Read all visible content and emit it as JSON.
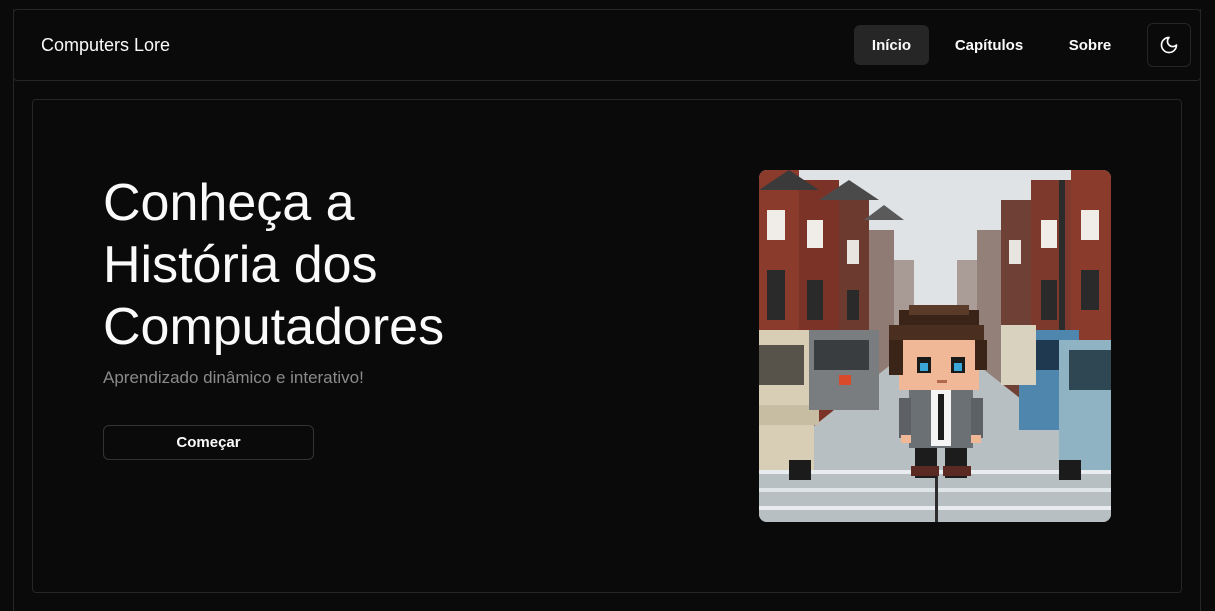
{
  "header": {
    "brand": "Computers Lore",
    "nav": [
      {
        "label": "Início",
        "active": true
      },
      {
        "label": "Capítulos",
        "active": false
      },
      {
        "label": "Sobre",
        "active": false
      }
    ],
    "theme_icon": "moon-icon"
  },
  "hero": {
    "title": "Conheça a História dos Computadores",
    "subtitle": "Aprendizado dinâmico e interativo!",
    "cta_label": "Começar",
    "illustration": "pixel-art-character-street"
  },
  "colors": {
    "background": "#0a0a0a",
    "border": "#262626",
    "active_nav": "#262626",
    "text": "#fafafa",
    "muted": "#8a8a8a"
  }
}
